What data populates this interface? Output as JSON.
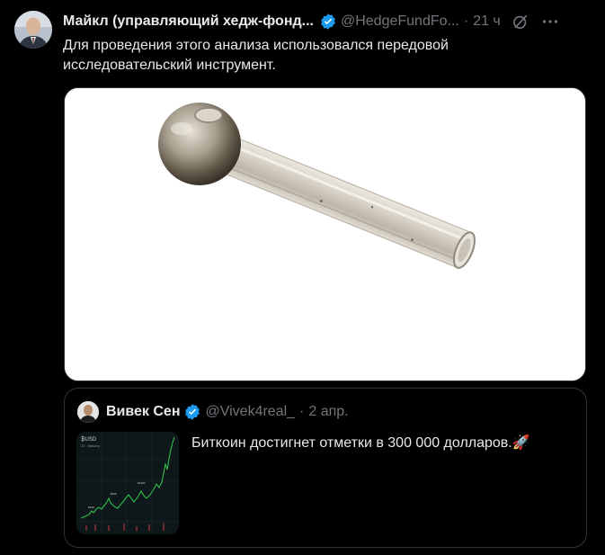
{
  "tweet": {
    "author": {
      "display_name": "Майкл (управляющий хедж-фонд...",
      "handle": "@HedgeFundFo...",
      "time": "21 ч",
      "separator": "·"
    },
    "text": "Для проведения этого анализа использовался передовой исследовательский инструмент.",
    "media": {
      "image": "glass-pipe-photo"
    }
  },
  "quote": {
    "author": {
      "display_name": "Вивек Сен",
      "handle": "@Vivek4real_",
      "time": "2 апр.",
      "separator": "·"
    },
    "text": "Биткоин достигнет отметки в 300 000 долларов.",
    "emoji": "🚀",
    "thumbnail": {
      "image": "bitcoin-price-chart",
      "title": "₿USD",
      "subtitle": "1D · Bitstamp"
    }
  },
  "colors": {
    "background": "#000000",
    "text_primary": "#e7e9ea",
    "text_secondary": "#71767b",
    "border": "#2f3336",
    "verified": "#1d9bf0",
    "chart_line": "#2fbf4a"
  }
}
